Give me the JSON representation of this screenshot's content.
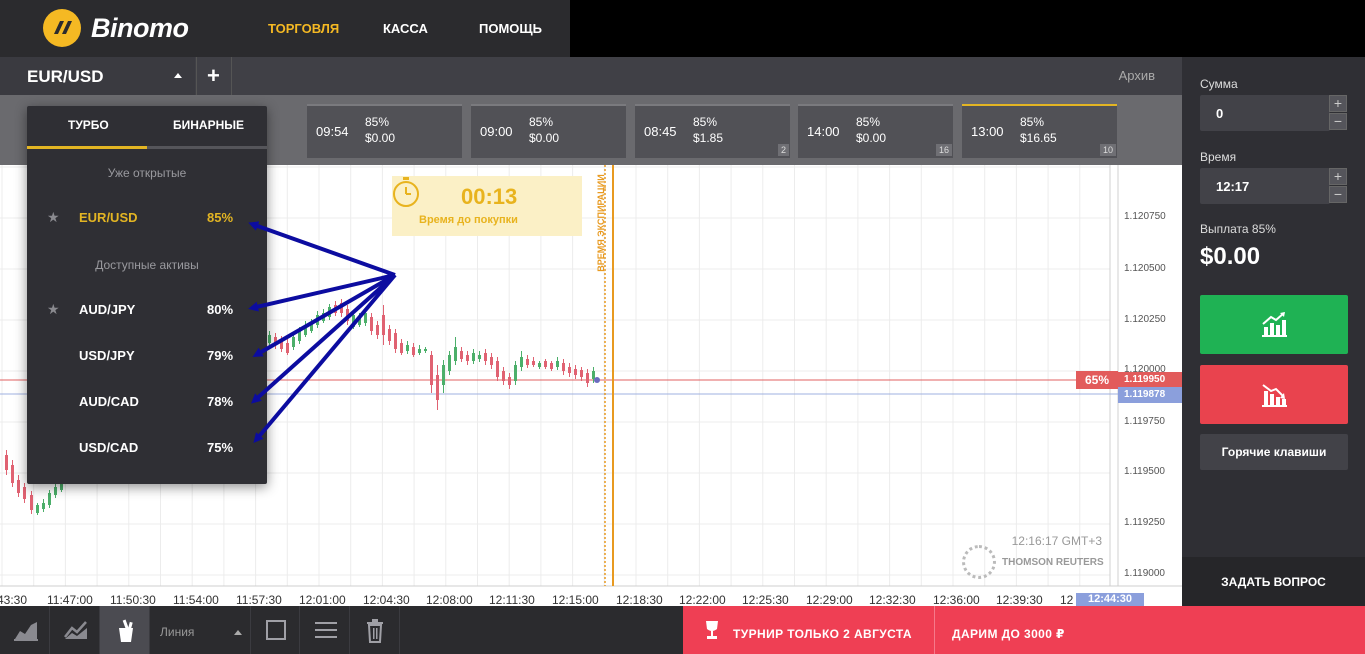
{
  "brand": {
    "name": "Binomo",
    "logo_color": "#f5b923"
  },
  "nav": {
    "trade": "ТОРГОВЛЯ",
    "cashier": "КАССА",
    "help": "ПОМОЩЬ",
    "active_color": "#f5b923"
  },
  "asset_tab": {
    "label": "EUR/USD",
    "add": "+",
    "archive": "Архив"
  },
  "expiry_cards": [
    {
      "time": "09:54",
      "pct": "85%",
      "payout": "$0.00",
      "badge": ""
    },
    {
      "time": "09:00",
      "pct": "85%",
      "payout": "$0.00",
      "badge": ""
    },
    {
      "time": "08:45",
      "pct": "85%",
      "payout": "$1.85",
      "badge": "2"
    },
    {
      "time": "14:00",
      "pct": "85%",
      "payout": "$0.00",
      "badge": "16"
    },
    {
      "time": "13:00",
      "pct": "85%",
      "payout": "$16.65",
      "badge": "10"
    }
  ],
  "dropdown": {
    "tab_turbo": "ТУРБО",
    "tab_binary": "БИНАРНЫЕ",
    "section_open": "Уже открытые",
    "section_available": "Доступные активы",
    "open_assets": [
      {
        "name": "EUR/USD",
        "pct": "85%",
        "star": true
      }
    ],
    "available_assets": [
      {
        "name": "AUD/JPY",
        "pct": "80%",
        "star": true
      },
      {
        "name": "USD/JPY",
        "pct": "79%",
        "star": false
      },
      {
        "name": "AUD/CAD",
        "pct": "78%",
        "star": false
      },
      {
        "name": "USD/CAD",
        "pct": "75%",
        "star": false
      }
    ]
  },
  "timer": {
    "value": "00:13",
    "label": "Время до покупки"
  },
  "expiry_label": "ВРЕМЯ ЭКСПИРАЦИИ",
  "chart": {
    "price_levels": [
      "1.120750",
      "1.120500",
      "1.120250",
      "1.120000",
      "1.119750",
      "1.119500",
      "1.119250",
      "1.119000"
    ],
    "current_price": "1.119950",
    "secondary_price": "1.119878",
    "payout_tag": "65%",
    "time_labels": [
      "43:30",
      "11:47:00",
      "11:50:30",
      "11:54:00",
      "11:57:30",
      "12:01:00",
      "12:04:30",
      "12:08:00",
      "12:11:30",
      "12:15:00",
      "12:18:30",
      "12:22:00",
      "12:25:30",
      "12:29:00",
      "12:32:30",
      "12:36:00",
      "12:39:30",
      "12"
    ],
    "time_tag": "12:44:30",
    "clock": "12:16:17 GMT+3",
    "provider": "THOMSON REUTERS",
    "up_color": "#4caf6a",
    "down_color": "#e06272"
  },
  "right_panel": {
    "amount_label": "Сумма",
    "amount_value": "0",
    "time_label": "Время",
    "time_value": "12:17",
    "plus": "+",
    "minus": "−",
    "payout_label": "Выплата 85%",
    "payout_value": "$0.00",
    "up_color": "#1fb254",
    "down_color": "#e9434e",
    "hotkeys": "Горячие клавиши",
    "ask": "ЗАДАТЬ ВОПРОС"
  },
  "toolbar": {
    "line_type": "Линия"
  },
  "promo": {
    "tournament": "ТУРНИР ТОЛЬКО 2 АВГУСТА",
    "gift": "ДАРИМ ДО 3000 ₽",
    "color": "#ef3f54"
  }
}
